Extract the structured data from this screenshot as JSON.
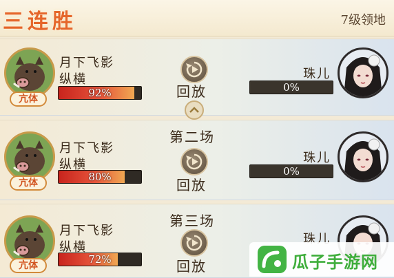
{
  "header": {
    "title": "三连胜",
    "territory_level": "7级领地"
  },
  "rounds": [
    {
      "label": "",
      "player": {
        "name_line1": "月下飞影",
        "name_line2": "纵横",
        "rank": "亢体",
        "percent_text": "92%",
        "percent": 92
      },
      "replay_label": "回放",
      "opponent": {
        "name": "珠儿",
        "percent_text": "0%",
        "percent": 0
      }
    },
    {
      "label": "第二场",
      "player": {
        "name_line1": "月下飞影",
        "name_line2": "纵横",
        "rank": "亢体",
        "percent_text": "80%",
        "percent": 80
      },
      "replay_label": "回放",
      "opponent": {
        "name": "珠儿",
        "percent_text": "0%",
        "percent": 0
      }
    },
    {
      "label": "第三场",
      "player": {
        "name_line1": "月下飞影",
        "name_line2": "纵横",
        "rank": "亢体",
        "percent_text": "72%",
        "percent": 72
      },
      "replay_label": "回放",
      "opponent": {
        "name": "珠儿",
        "percent_text": "",
        "percent": 0
      }
    }
  ],
  "watermark": {
    "text": "瓜子手游网"
  },
  "colors": {
    "title_orange": "#e5662a",
    "hp_red": "#c8241d",
    "hp_orange": "#f0a852",
    "bar_dark": "#2f2a24",
    "rank_text": "#d2541f",
    "watermark_green": "#43b444"
  },
  "icons": {
    "replay": "replay-icon",
    "collapse": "chevron-up-icon",
    "player_avatar": "boar-avatar-icon",
    "opponent_avatar": "girl-avatar-icon"
  }
}
